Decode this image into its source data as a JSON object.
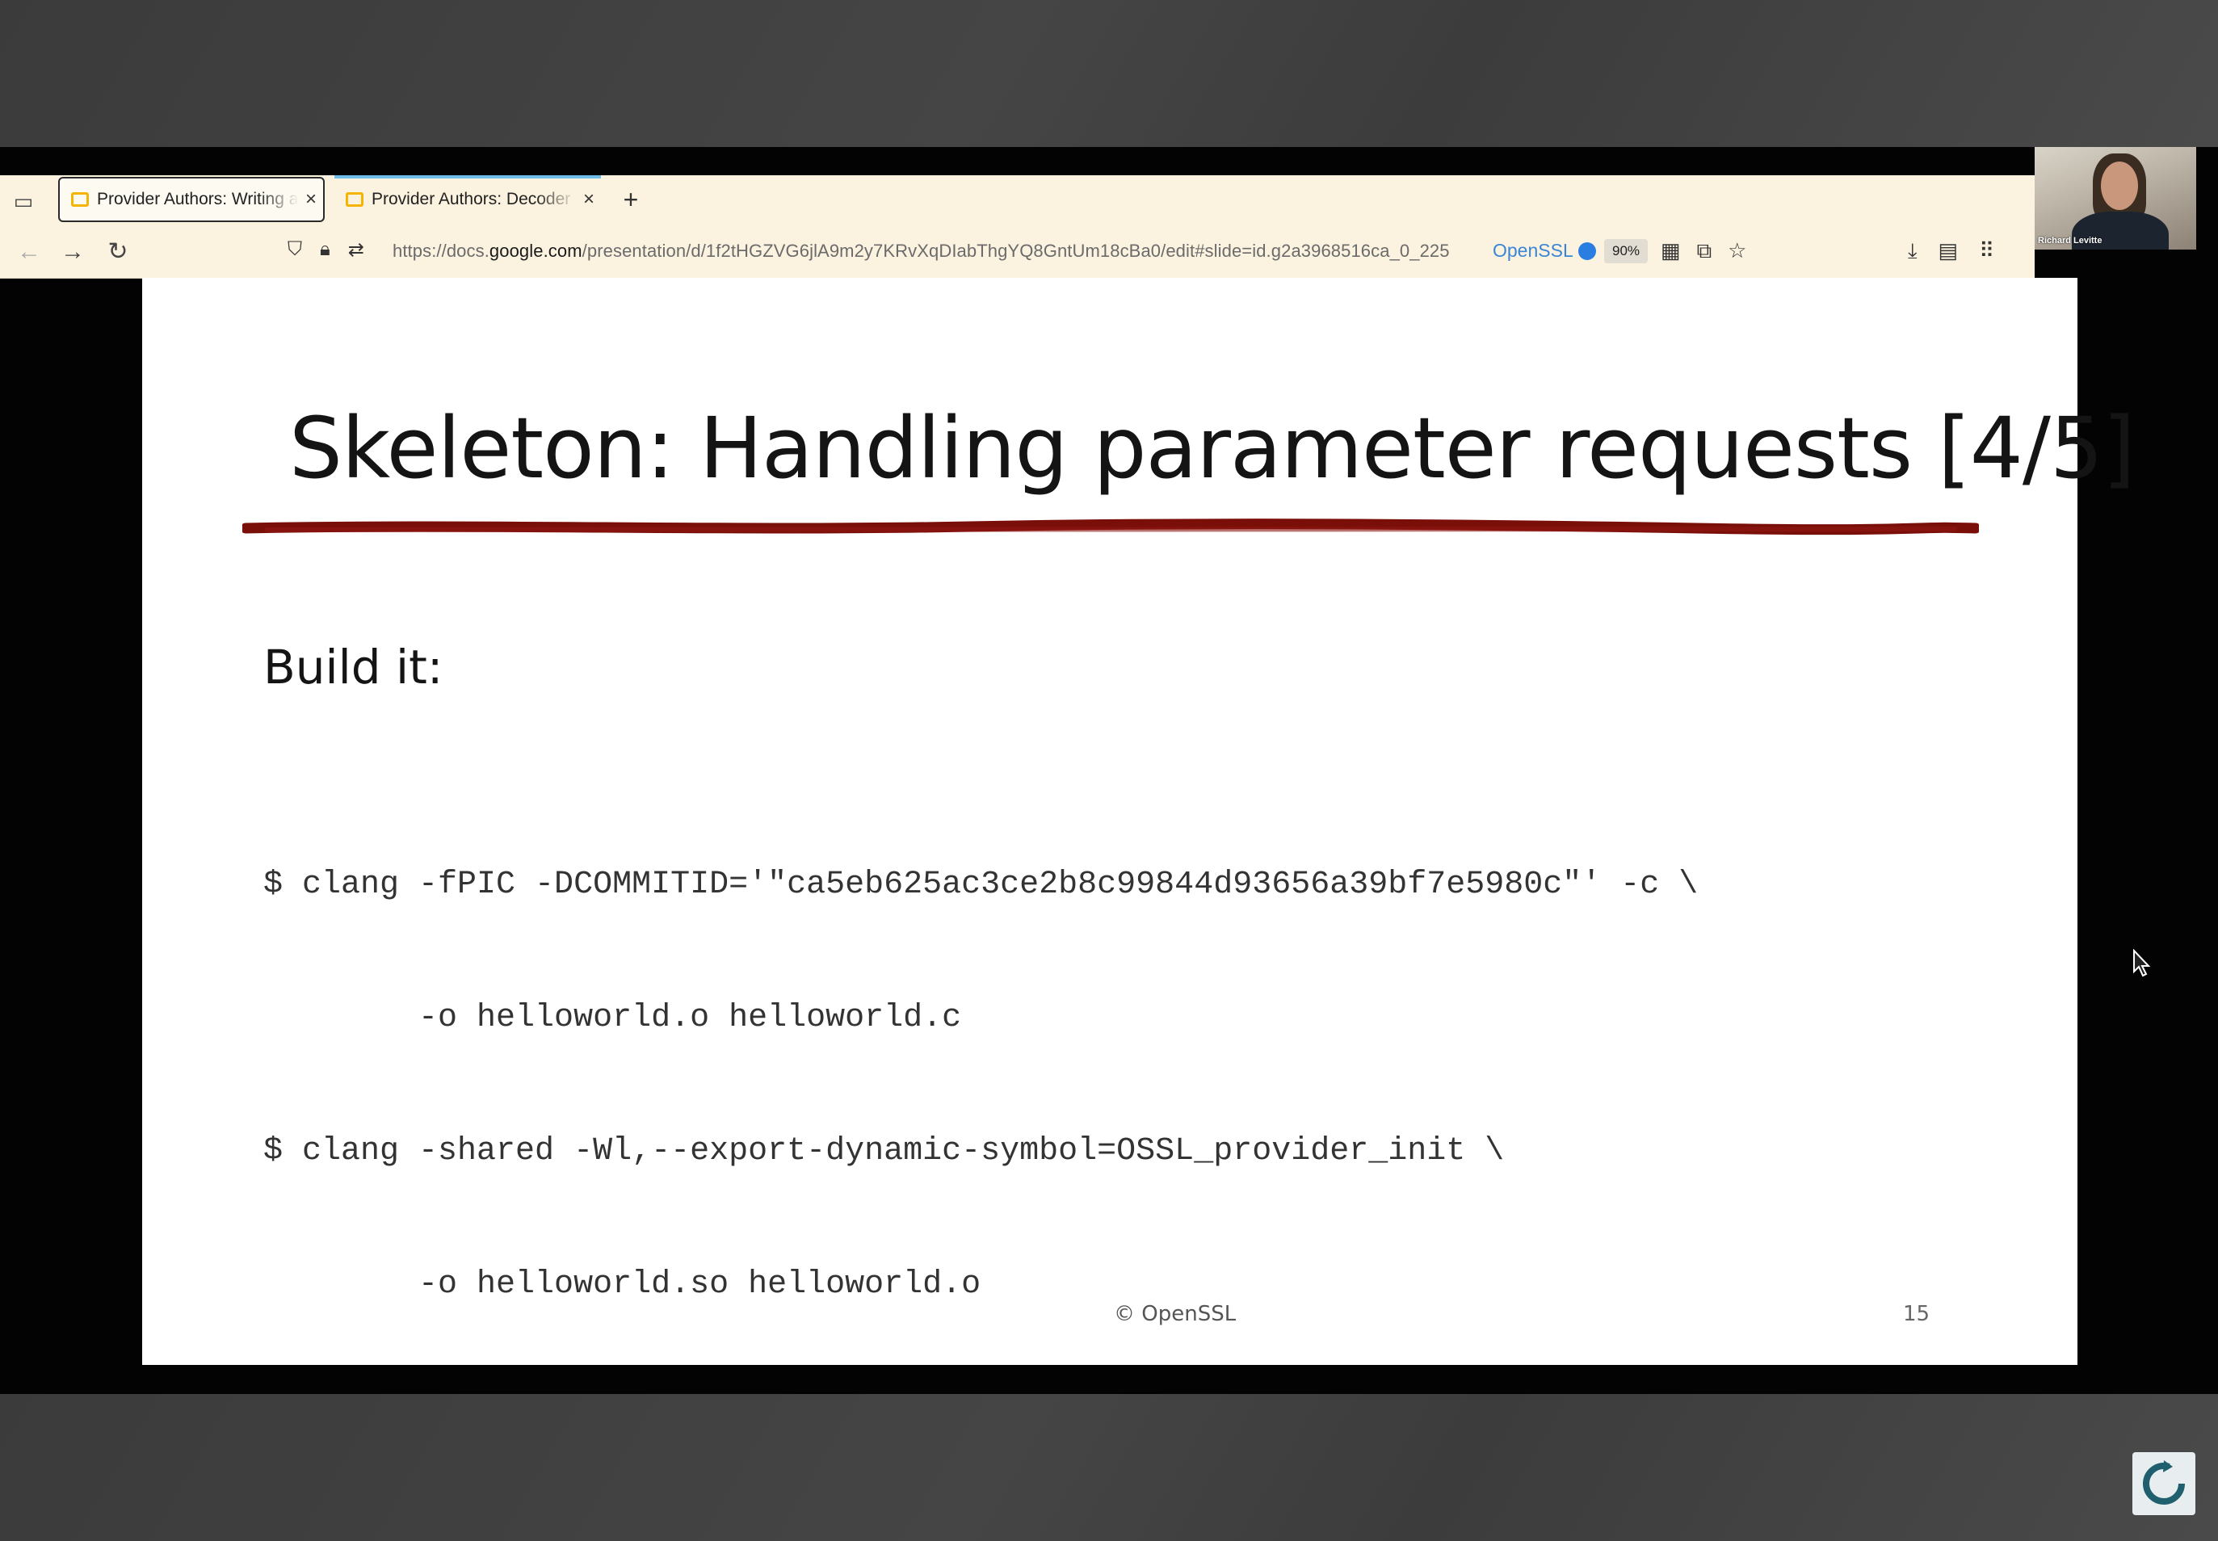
{
  "browser": {
    "tabs": [
      {
        "title": "Provider Authors: Writing a",
        "close": "×",
        "active": true
      },
      {
        "title": "Provider Authors: Decoder",
        "close": "×",
        "active": false
      }
    ],
    "new_tab": "+",
    "url_prefix": "https://docs.",
    "url_domain": "google.com",
    "url_path": "/presentation/d/1f2tHGZVG6jlA9m2y7KRvXqDIabThgYQ8GntUm18cBa0/edit#slide=id.g2a3968516ca_0_225",
    "container_label": "OpenSSL",
    "zoom": "90%"
  },
  "webcam": {
    "name": "Richard Levitte"
  },
  "slide": {
    "title": "Skeleton: Handling parameter requests [4/5]",
    "subheading": "Build it:",
    "code_lines": [
      "$ clang -fPIC -DCOMMITID='\"ca5eb625ac3ce2b8c99844d93656a39bf7e5980c\"' -c \\",
      "        -o helloworld.o helloworld.c",
      "$ clang -shared -Wl,--export-dynamic-symbol=OSSL_provider_init \\",
      "        -o helloworld.so helloworld.o"
    ],
    "footer": "© OpenSSL",
    "page_number": "15"
  },
  "colors": {
    "underline": "#7a0f0a",
    "tab_accent": "#6fbde8",
    "container": "#2a7de1",
    "favicon": "#f4b400"
  },
  "icons": [
    "tab-overview-icon",
    "back-icon",
    "forward-icon",
    "reload-icon",
    "shield-icon",
    "lock-icon",
    "permissions-icon",
    "container-dot-icon",
    "qr-icon",
    "screenshot-icon",
    "bookmark-star-icon",
    "download-icon",
    "reader-icon",
    "apps-icon",
    "extensions-icon",
    "menu-icon",
    "mouse-cursor-icon",
    "refresh-logo-icon"
  ]
}
